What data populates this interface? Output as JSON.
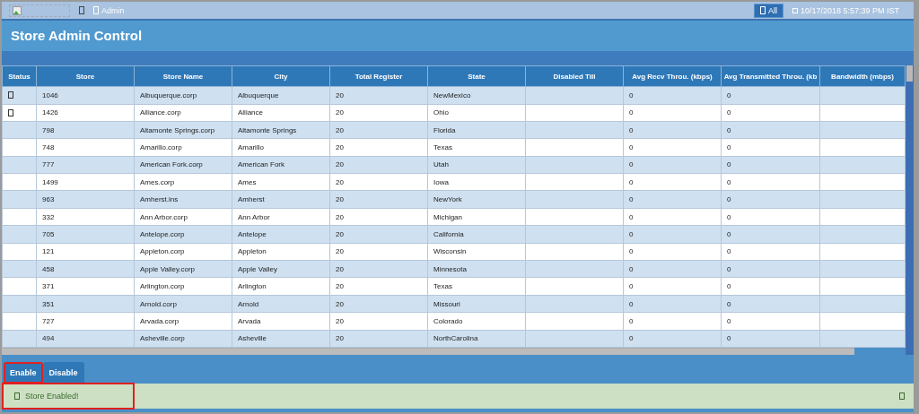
{
  "top_bar": {
    "user": "Admin",
    "filter_button": "All",
    "timestamp": "10/17/2018 5:57:39 PM IST"
  },
  "title": "Store Admin Control",
  "table": {
    "columns": [
      "Status",
      "Store",
      "Store Name",
      "City",
      "Total Register",
      "State",
      "Disabled Till",
      "Avg Recv Throu. (kbps)",
      "Avg Transmitted Throu. (kb",
      "Bandwidth (mbps)"
    ],
    "rows": [
      {
        "status_icon": true,
        "store": "1046",
        "store_name": "Albuquerque.corp",
        "city": "Albuquerque",
        "total_register": "20",
        "state": "NewMexico",
        "avg_recv": "0",
        "avg_transmitted": "0"
      },
      {
        "status_icon": true,
        "store": "1426",
        "store_name": "Alliance.corp",
        "city": "Alliance",
        "total_register": "20",
        "state": "Ohio",
        "avg_recv": "0",
        "avg_transmitted": "0"
      },
      {
        "status_icon": false,
        "store": "798",
        "store_name": "Altamonte Springs.corp",
        "city": "Altamonte Springs",
        "total_register": "20",
        "state": "Florida",
        "avg_recv": "0",
        "avg_transmitted": "0"
      },
      {
        "status_icon": false,
        "store": "748",
        "store_name": "Amarillo.corp",
        "city": "Amarillo",
        "total_register": "20",
        "state": "Texas",
        "avg_recv": "0",
        "avg_transmitted": "0"
      },
      {
        "status_icon": false,
        "store": "777",
        "store_name": "American Fork.corp",
        "city": "American Fork",
        "total_register": "20",
        "state": "Utah",
        "avg_recv": "0",
        "avg_transmitted": "0"
      },
      {
        "status_icon": false,
        "store": "1499",
        "store_name": "Ames.corp",
        "city": "Ames",
        "total_register": "20",
        "state": "Iowa",
        "avg_recv": "0",
        "avg_transmitted": "0"
      },
      {
        "status_icon": false,
        "store": "963",
        "store_name": "Amherst.ins",
        "city": "Amherst",
        "total_register": "20",
        "state": "NewYork",
        "avg_recv": "0",
        "avg_transmitted": "0"
      },
      {
        "status_icon": false,
        "store": "332",
        "store_name": "Ann Arbor.corp",
        "city": "Ann Arbor",
        "total_register": "20",
        "state": "Michigan",
        "avg_recv": "0",
        "avg_transmitted": "0"
      },
      {
        "status_icon": false,
        "store": "705",
        "store_name": "Antelope.corp",
        "city": "Antelope",
        "total_register": "20",
        "state": "California",
        "avg_recv": "0",
        "avg_transmitted": "0"
      },
      {
        "status_icon": false,
        "store": "121",
        "store_name": "Appleton.corp",
        "city": "Appleton",
        "total_register": "20",
        "state": "Wisconsin",
        "avg_recv": "0",
        "avg_transmitted": "0"
      },
      {
        "status_icon": false,
        "store": "458",
        "store_name": "Apple Valley.corp",
        "city": "Apple Valley",
        "total_register": "20",
        "state": "Minnesota",
        "avg_recv": "0",
        "avg_transmitted": "0"
      },
      {
        "status_icon": false,
        "store": "371",
        "store_name": "Arlington.corp",
        "city": "Arlington",
        "total_register": "20",
        "state": "Texas",
        "avg_recv": "0",
        "avg_transmitted": "0"
      },
      {
        "status_icon": false,
        "store": "351",
        "store_name": "Arnold.corp",
        "city": "Arnold",
        "total_register": "20",
        "state": "Missouri",
        "avg_recv": "0",
        "avg_transmitted": "0"
      },
      {
        "status_icon": false,
        "store": "727",
        "store_name": "Arvada.corp",
        "city": "Arvada",
        "total_register": "20",
        "state": "Colorado",
        "avg_recv": "0",
        "avg_transmitted": "0"
      },
      {
        "status_icon": false,
        "store": "494",
        "store_name": "Asheville.corp",
        "city": "Asheville",
        "total_register": "20",
        "state": "NorthCarolina",
        "avg_recv": "0",
        "avg_transmitted": "0"
      }
    ]
  },
  "buttons": [
    {
      "label": "Enable",
      "highlighted": true
    },
    {
      "label": "Disable",
      "highlighted": false
    }
  ],
  "message": {
    "text": "Store Enabled!",
    "highlighted": true
  }
}
